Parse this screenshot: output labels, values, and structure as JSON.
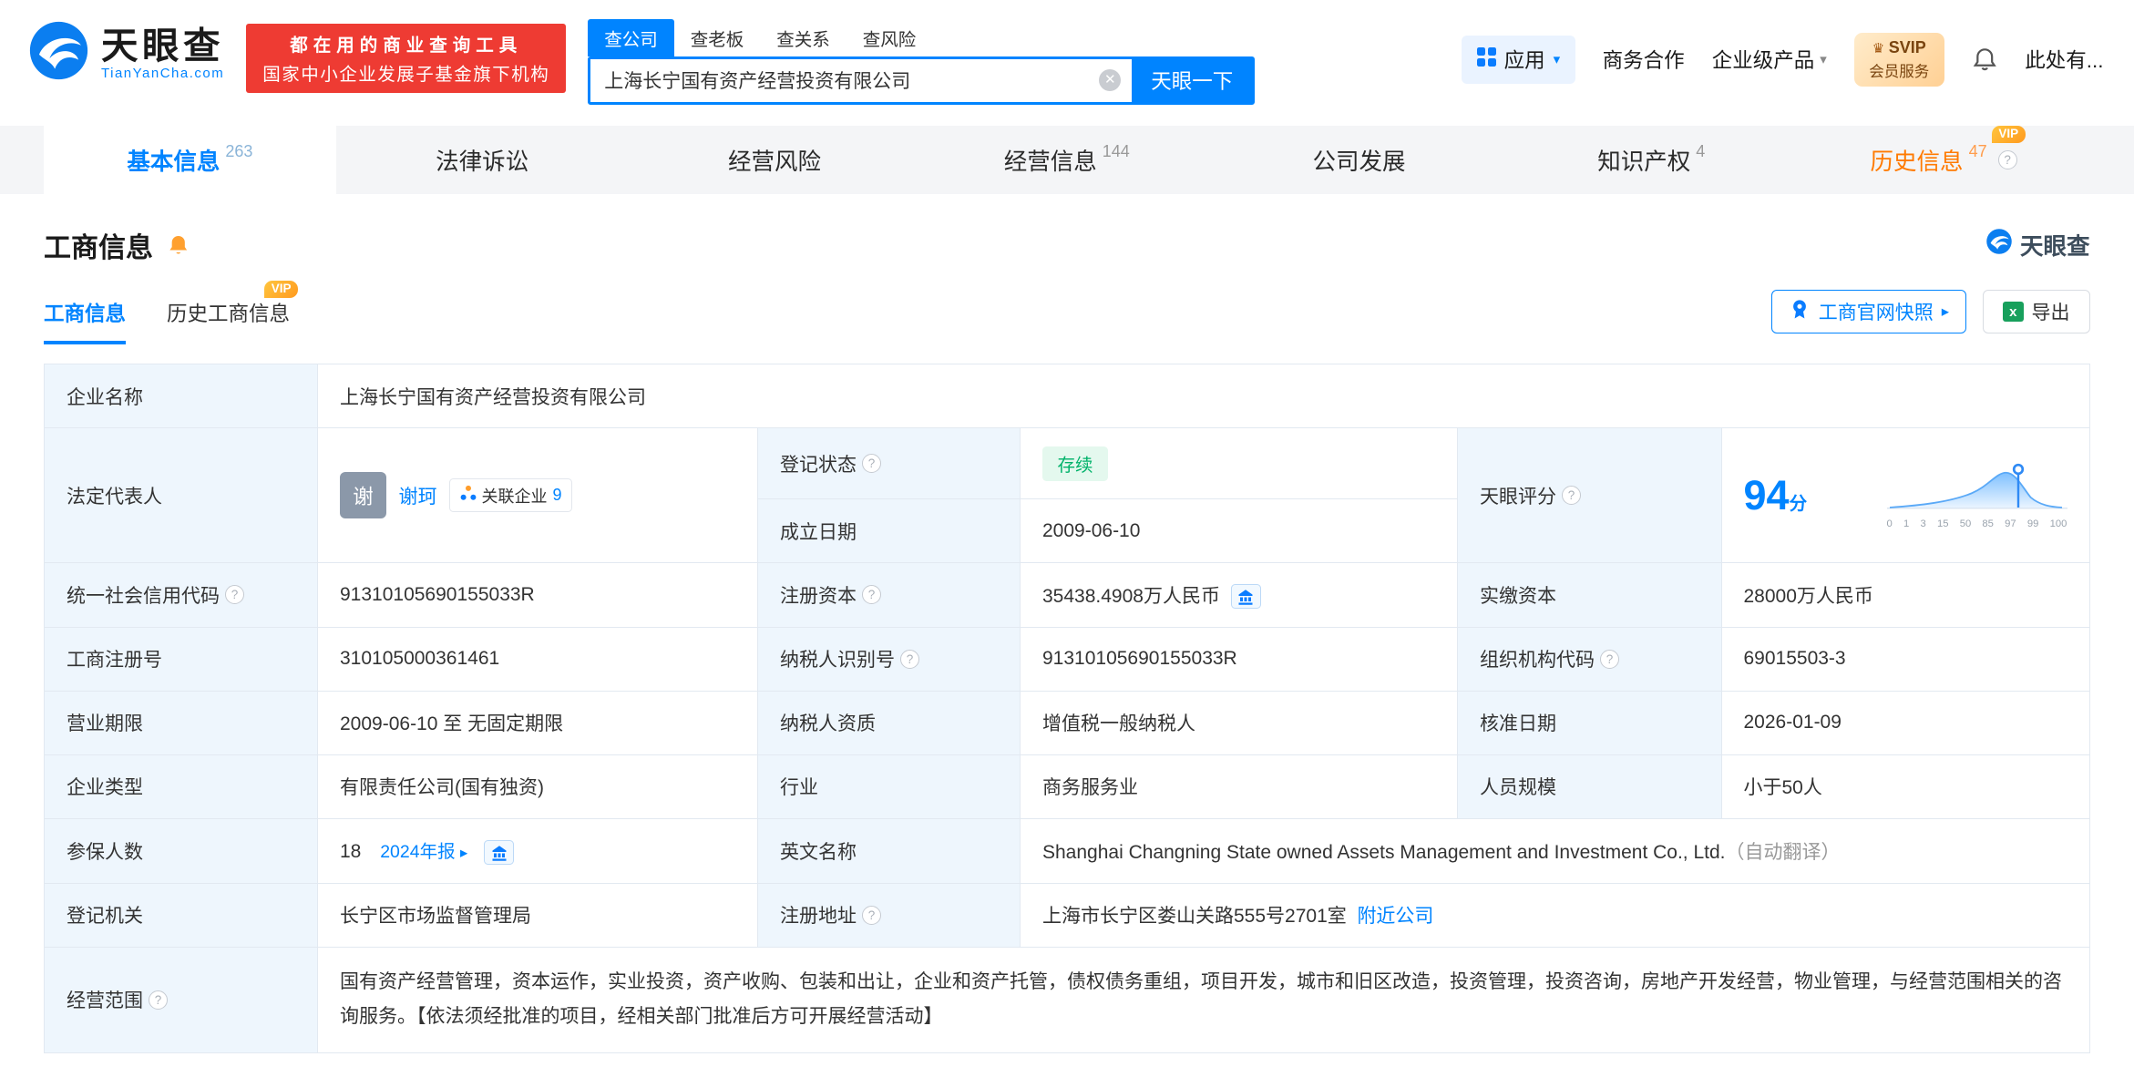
{
  "colors": {
    "accent": "#0084ff",
    "vip_orange": "#ff7a00",
    "status_green": "#00b26a",
    "promo_red": "#ee3b33"
  },
  "icons": {
    "question": "?",
    "caret_down": "▾",
    "arrow_right": "▸",
    "clear": "✕",
    "crown": "♛",
    "excel_x": "x"
  },
  "badges": {
    "vip": "VIP"
  },
  "header": {
    "logo_cn": "天眼查",
    "logo_en": "TianYanCha.com",
    "promo_line1": "都在用的商业查询工具",
    "promo_line2": "国家中小企业发展子基金旗下机构",
    "search_tabs": [
      {
        "label": "查公司"
      },
      {
        "label": "查老板"
      },
      {
        "label": "查关系"
      },
      {
        "label": "查风险"
      }
    ],
    "search_value": "上海长宁国有资产经营投资有限公司",
    "search_button": "天眼一下",
    "apps": "应用",
    "cooperation": "商务合作",
    "enterprise": "企业级产品",
    "svip_top": "SVIP",
    "svip_bottom": "会员服务",
    "user": "此处有..."
  },
  "nav": {
    "tabs": [
      {
        "label": "基本信息",
        "count": "263"
      },
      {
        "label": "法律诉讼",
        "count": ""
      },
      {
        "label": "经营风险",
        "count": ""
      },
      {
        "label": "经营信息",
        "count": "144"
      },
      {
        "label": "公司发展",
        "count": ""
      },
      {
        "label": "知识产权",
        "count": "4"
      },
      {
        "label": "历史信息",
        "count": "47"
      }
    ]
  },
  "section": {
    "title": "工商信息",
    "watermark": "天眼查",
    "subtab_active": "工商信息",
    "subtab_history": "历史工商信息",
    "snapshot_button": "工商官网快照",
    "export_button": "导出"
  },
  "fields": {
    "company_name_label": "企业名称",
    "company_name": "上海长宁国有资产经营投资有限公司",
    "legal_rep_label": "法定代表人",
    "legal_rep_avatar": "谢",
    "legal_rep_name": "谢珂",
    "related_text": "关联企业",
    "related_count": "9",
    "reg_status_label": "登记状态",
    "reg_status": "存续",
    "establish_label": "成立日期",
    "establish_date": "2009-06-10",
    "score_label": "天眼评分",
    "score": "94",
    "score_unit": "分",
    "credit_code_label": "统一社会信用代码",
    "credit_code": "91310105690155033R",
    "reg_capital_label": "注册资本",
    "reg_capital": "35438.4908万人民币",
    "paid_capital_label": "实缴资本",
    "paid_capital": "28000万人民币",
    "reg_number_label": "工商注册号",
    "reg_number": "310105000361461",
    "taxpayer_id_label": "纳税人识别号",
    "taxpayer_id": "91310105690155033R",
    "org_code_label": "组织机构代码",
    "org_code": "69015503-3",
    "business_term_label": "营业期限",
    "business_term": "2009-06-10 至 无固定期限",
    "taxpayer_quality_label": "纳税人资质",
    "taxpayer_quality": "增值税一般纳税人",
    "approval_date_label": "核准日期",
    "approval_date": "2026-01-09",
    "company_type_label": "企业类型",
    "company_type": "有限责任公司(国有独资)",
    "industry_label": "行业",
    "industry": "商务服务业",
    "staff_size_label": "人员规模",
    "staff_size": "小于50人",
    "insured_label": "参保人数",
    "insured_count": "18",
    "annual_report": "2024年报",
    "english_name_label": "英文名称",
    "english_name": "Shanghai Changning State owned Assets Management and Investment Co., Ltd.",
    "english_name_note": "（自动翻译）",
    "reg_authority_label": "登记机关",
    "reg_authority": "长宁区市场监督管理局",
    "address_label": "注册地址",
    "address": "上海市长宁区娄山关路555号2701室",
    "nearby_link": "附近公司",
    "business_scope_label": "经营范围",
    "business_scope": "国有资产经营管理，资本运作，实业投资，资产收购、包装和出让，企业和资产托管，债权债务重组，项目开发，城市和旧区改造，投资管理，投资咨询，房地产开发经营，物业管理，与经营范围相关的咨询服务。【依法须经批准的项目，经相关部门批准后方可开展经营活动】"
  },
  "score_chart": {
    "type": "area",
    "score_value": 94,
    "x_labels": [
      "0",
      "1",
      "3",
      "15",
      "50",
      "85",
      "97",
      "99",
      "100"
    ]
  }
}
